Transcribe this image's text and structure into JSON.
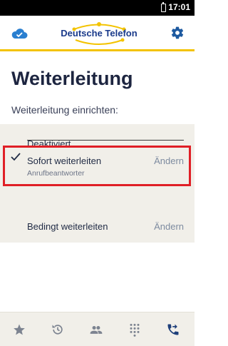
{
  "status_bar": {
    "time": "17:01"
  },
  "app_bar": {
    "brand": "Deutsche Telefon",
    "cloud_icon": "cloud-icon",
    "settings_icon": "gear-icon"
  },
  "page": {
    "title": "Weiterleitung",
    "subtitle": "Weiterleitung einrichten:"
  },
  "options": [
    {
      "label": "Deaktiviert"
    },
    {
      "label": "Sofort weiterleiten",
      "sublabel": "Anrufbeantworter",
      "action": "Ändern",
      "selected": true
    },
    {
      "label": "Bedingt weiterleiten",
      "action": "Ändern"
    }
  ],
  "bottom_nav": {
    "items": [
      {
        "icon": "star-icon"
      },
      {
        "icon": "history-icon"
      },
      {
        "icon": "contacts-icon"
      },
      {
        "icon": "dialpad-icon"
      },
      {
        "icon": "call-forward-icon",
        "active": true
      }
    ]
  },
  "colors": {
    "accent_yellow": "#f3c300",
    "highlight_red": "#e01f26",
    "brand_blue": "#1a3a8a",
    "panel_bg": "#f1efe9"
  }
}
